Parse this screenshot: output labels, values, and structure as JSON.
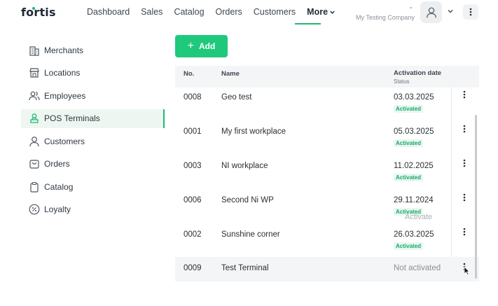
{
  "header": {
    "logo": "fortis",
    "nav": [
      {
        "label": "Dashboard"
      },
      {
        "label": "Sales"
      },
      {
        "label": "Catalog"
      },
      {
        "label": "Orders"
      },
      {
        "label": "Customers"
      },
      {
        "label": "More"
      }
    ],
    "user_dash": "-",
    "company": "My Testing Company"
  },
  "sidebar": {
    "items": [
      {
        "label": "Merchants",
        "icon": "building-icon"
      },
      {
        "label": "Locations",
        "icon": "store-icon"
      },
      {
        "label": "Employees",
        "icon": "users-icon"
      },
      {
        "label": "POS Terminals",
        "icon": "pos-terminal-icon",
        "active": true
      },
      {
        "label": "Customers",
        "icon": "user-icon"
      },
      {
        "label": "Orders",
        "icon": "bag-icon"
      },
      {
        "label": "Catalog",
        "icon": "clipboard-icon"
      },
      {
        "label": "Loyalty",
        "icon": "percent-icon"
      }
    ]
  },
  "toolbar": {
    "add_label": "Add"
  },
  "table": {
    "columns": {
      "no": "No.",
      "name": "Name",
      "activation": "Activation date",
      "status": "Status"
    },
    "rows": [
      {
        "no": "0008",
        "name": "Geo test",
        "date": "03.03.2025",
        "status": "Activated"
      },
      {
        "no": "0001",
        "name": "My first workplace",
        "date": "05.03.2025",
        "status": "Activated"
      },
      {
        "no": "0003",
        "name": "NI workplace",
        "date": "11.02.2025",
        "status": "Activated"
      },
      {
        "no": "0006",
        "name": "Second Ni WP",
        "date": "29.11.2024",
        "status": "Activated"
      },
      {
        "no": "0002",
        "name": "Sunshine corner",
        "date": "26.03.2025",
        "status": "Activated"
      },
      {
        "no": "0009",
        "name": "Test Terminal",
        "date": "",
        "status": "Not activated"
      }
    ],
    "ghost_text": "Activate"
  },
  "colors": {
    "accent": "#1fc97c",
    "active_bg": "#eef6f1",
    "badge_text": "#1aa868"
  }
}
